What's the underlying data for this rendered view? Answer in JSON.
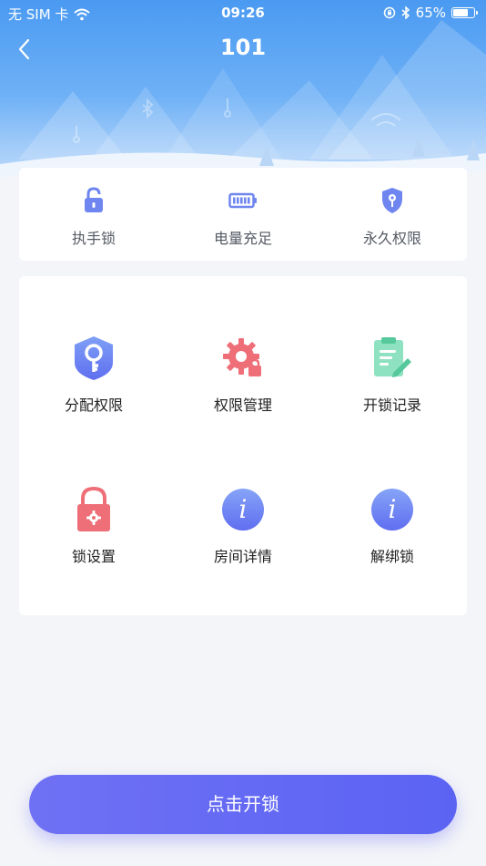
{
  "status_bar": {
    "carrier": "无 SIM 卡",
    "time": "09:26",
    "battery_percent": "65%",
    "battery_level": 0.65,
    "icons": [
      "wifi-icon",
      "rotation-lock-icon",
      "bluetooth-icon",
      "battery-icon"
    ]
  },
  "header": {
    "title": "101",
    "back_icon": "chevron-left-icon"
  },
  "info_bar": [
    {
      "label": "执手锁",
      "icon": "padlock-icon"
    },
    {
      "label": "电量充足",
      "icon": "battery-full-icon"
    },
    {
      "label": "永久权限",
      "icon": "shield-key-icon"
    }
  ],
  "menu": [
    {
      "label": "分配权限",
      "icon": "key-shield-icon"
    },
    {
      "label": "权限管理",
      "icon": "gear-lock-icon"
    },
    {
      "label": "开锁记录",
      "icon": "clipboard-edit-icon"
    },
    {
      "label": "锁设置",
      "icon": "lock-settings-icon"
    },
    {
      "label": "房间详情",
      "icon": "info-icon"
    },
    {
      "label": "解绑锁",
      "icon": "info-icon"
    }
  ],
  "unlock_button": {
    "label": "点击开锁"
  },
  "colors": {
    "accent": "#6a6cf4",
    "icon_blue": "#6f86f0",
    "icon_red": "#ee6f78",
    "icon_green": "#6fd9b0",
    "header_top": "#4a9af2"
  }
}
